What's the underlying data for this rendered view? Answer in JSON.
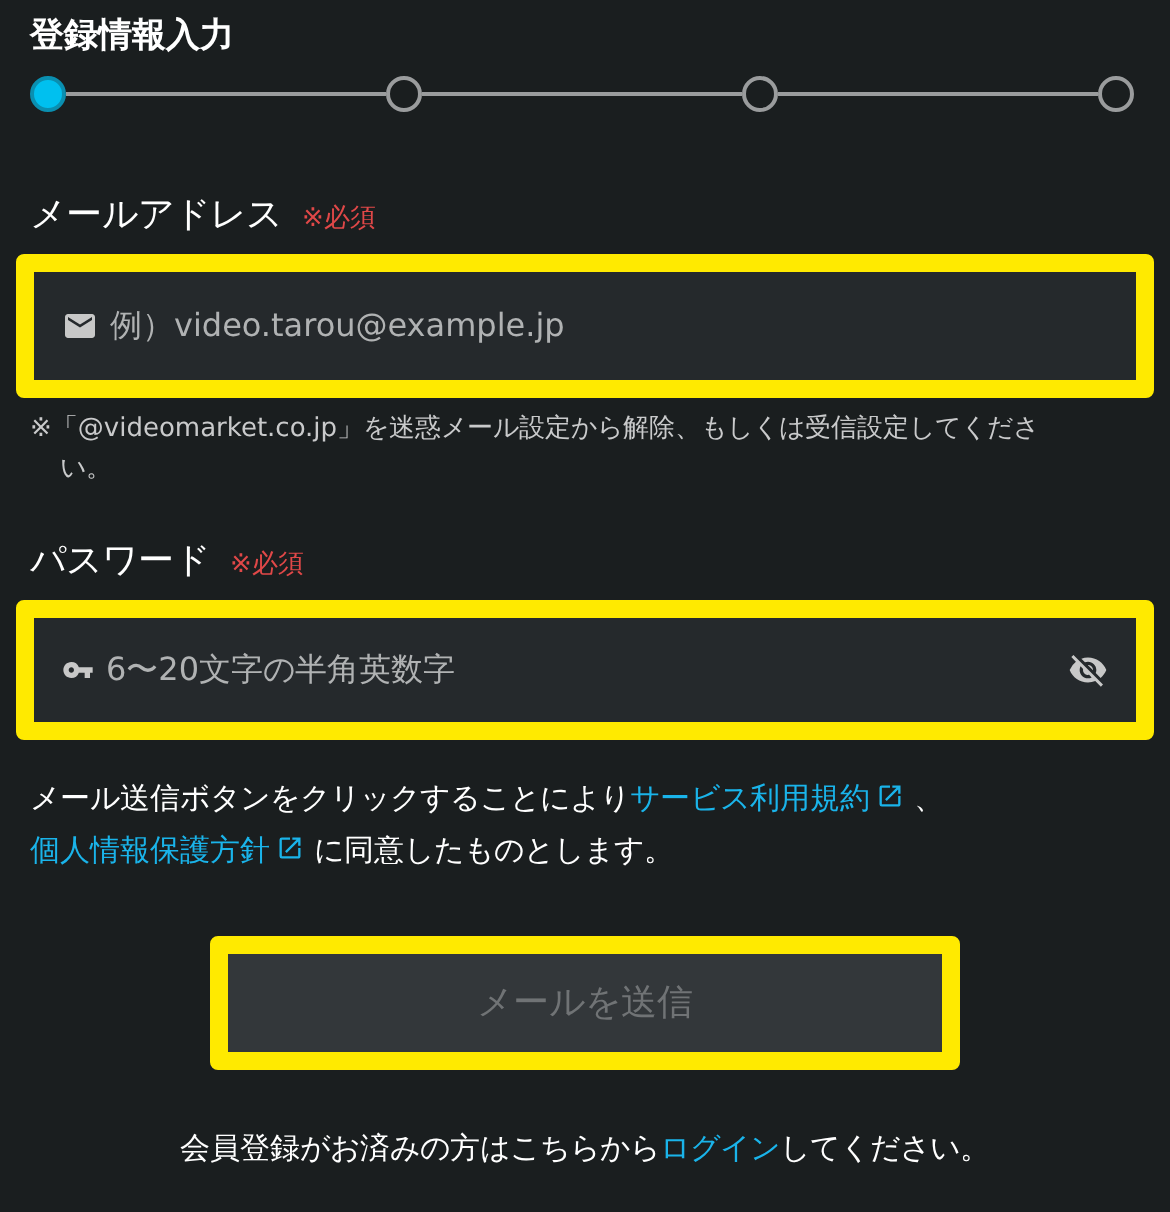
{
  "title": "登録情報入力",
  "steps": [
    {
      "selected": true
    },
    {
      "selected": false
    },
    {
      "selected": false
    },
    {
      "selected": false
    }
  ],
  "email": {
    "label": "メールアドレス",
    "required": "※必須",
    "placeholder": "例）video.tarou@example.jp",
    "note": "※「@videomarket.co.jp」を迷惑メール設定から解除、もしくは受信設定してください。"
  },
  "password": {
    "label": "パスワード",
    "required": "※必須",
    "placeholder": "6〜20文字の半角英数字"
  },
  "consent": {
    "before": "メール送信ボタンをクリックすることにより",
    "link1": "サービス利用規約",
    "between": "、",
    "link2": "個人情報保護方針",
    "after": "に同意したものとします。"
  },
  "submit": {
    "label": "メールを送信",
    "disabled": true
  },
  "login": {
    "before": "会員登録がお済みの方はこちらから",
    "link": "ログイン",
    "after": "してください。"
  }
}
